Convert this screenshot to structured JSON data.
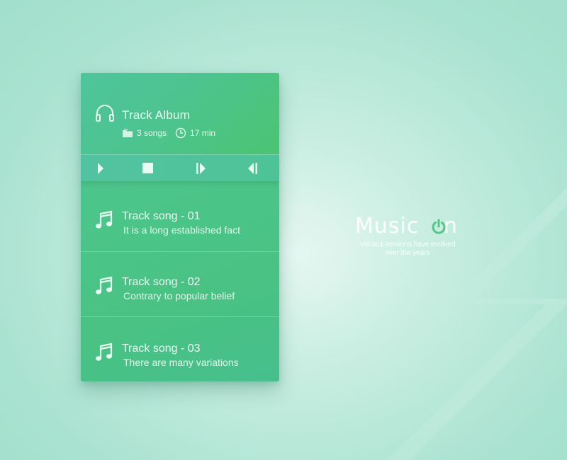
{
  "album": {
    "title": "Track Album",
    "songs_count": "3 songs",
    "duration": "17 min"
  },
  "controls": {
    "items": [
      "play-icon",
      "stop-icon",
      "next-icon",
      "previous-icon"
    ]
  },
  "tracks": [
    {
      "title": "Track song - 01",
      "subtitle": "It is a long established fact"
    },
    {
      "title": "Track song - 02",
      "subtitle": "Contrary to popular belief"
    },
    {
      "title": "Track song - 03",
      "subtitle": "There are many variations"
    }
  ],
  "brand": {
    "name_part1": "Music ",
    "name_part2": "n",
    "tagline_line1": "Various versions have evolved",
    "tagline_line2": "over the years"
  },
  "colors": {
    "accent": "#4cc58a",
    "logo_power": "#54c686"
  }
}
